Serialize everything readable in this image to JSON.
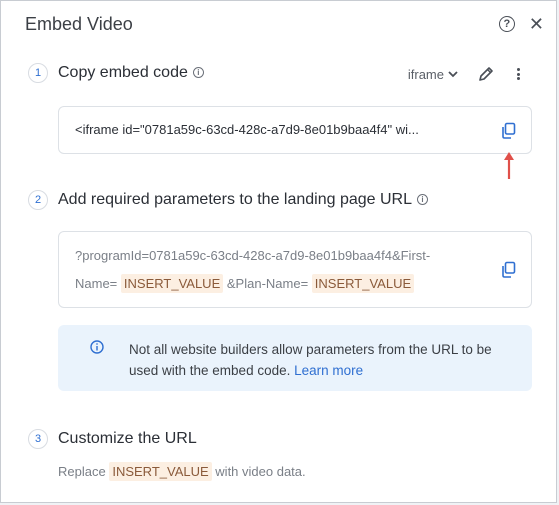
{
  "dialog": {
    "title": "Embed Video"
  },
  "step1": {
    "number": "1",
    "title": "Copy embed code",
    "format": "iframe",
    "code": "<iframe id=\"0781a59c-63cd-428c-a7d9-8e01b9baa4f4\" wi..."
  },
  "step2": {
    "number": "2",
    "title": "Add required parameters to the landing page URL",
    "line1": "?programId=0781a59c-63cd-428c-a7d9-8e01b9baa4f4&First-",
    "line2_prefix": "Name=",
    "token": "INSERT_VALUE",
    "line2_middle": "&Plan-Name=",
    "notice_text": "Not all website builders allow parameters from the URL to be used with the embed code.",
    "notice_link": "Learn more"
  },
  "step3": {
    "number": "3",
    "title": "Customize the URL",
    "replace_prefix": "Replace",
    "token": "INSERT_VALUE",
    "replace_suffix": "with video data."
  },
  "colors": {
    "accent": "#2f6fd1",
    "token_bg": "#fcefe2",
    "notice_bg": "#eaf3fc",
    "arrow": "#e0504a"
  }
}
